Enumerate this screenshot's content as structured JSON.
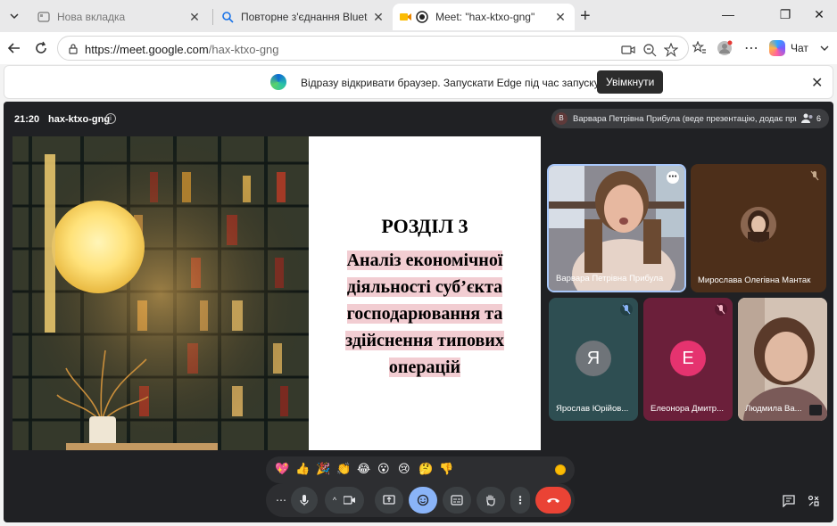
{
  "tabs": [
    {
      "title": "Нова вкладка",
      "active": false
    },
    {
      "title": "Повторне з'єднання Bluetooth-на",
      "active": false
    },
    {
      "title": "Meet: \"hax-ktxo-gng\"",
      "active": true
    }
  ],
  "address_bar": {
    "host": "https://meet.google.com",
    "path": "/hax-ktxo-gng"
  },
  "chat_button": "Чат",
  "infobar": {
    "message": "Відразу відкривати браузер. Запускати Edge під час запуску Windows.",
    "button": "Увімкнути"
  },
  "meet": {
    "time": "21:20",
    "meeting_code": "hax-ktxo-gng",
    "presenter_avatar": "В",
    "presenter_text": "Варвара Петрівна Прибула (веде презентацію, додає примітки)",
    "participant_count": "6",
    "slide": {
      "heading": "РОЗДІЛ 3",
      "body_lines": [
        "Аналіз економічної",
        "діяльності суб’єкта",
        "господарювання та",
        "здійснення типових",
        "операцій"
      ]
    },
    "participants": [
      {
        "name": "Варвара Петрівна Прибула",
        "video": true
      },
      {
        "name": "Мирослава Олегівна Мантак",
        "video": false,
        "muted": true
      },
      {
        "name": "Ярослав Юрійов...",
        "initial": "Я",
        "muted": true
      },
      {
        "name": "Елеонора Дмитр...",
        "initial": "Е",
        "muted": true
      },
      {
        "name": "Людмила Ва...",
        "video": true
      }
    ],
    "reactions": [
      "💖",
      "👍",
      "🎉",
      "👏",
      "😂",
      "😮",
      "😢",
      "🤔",
      "👎"
    ],
    "colors": {
      "end_call": "#ea4335",
      "active_control": "#8ab4f8",
      "meet_bg": "#202124",
      "slide_highlight": "#f2cdd2",
      "tile_teal": "#2e4e52",
      "tile_magenta": "#6b1f3a",
      "avatar_grey": "#6f7479",
      "avatar_pink": "#e5336f"
    }
  }
}
